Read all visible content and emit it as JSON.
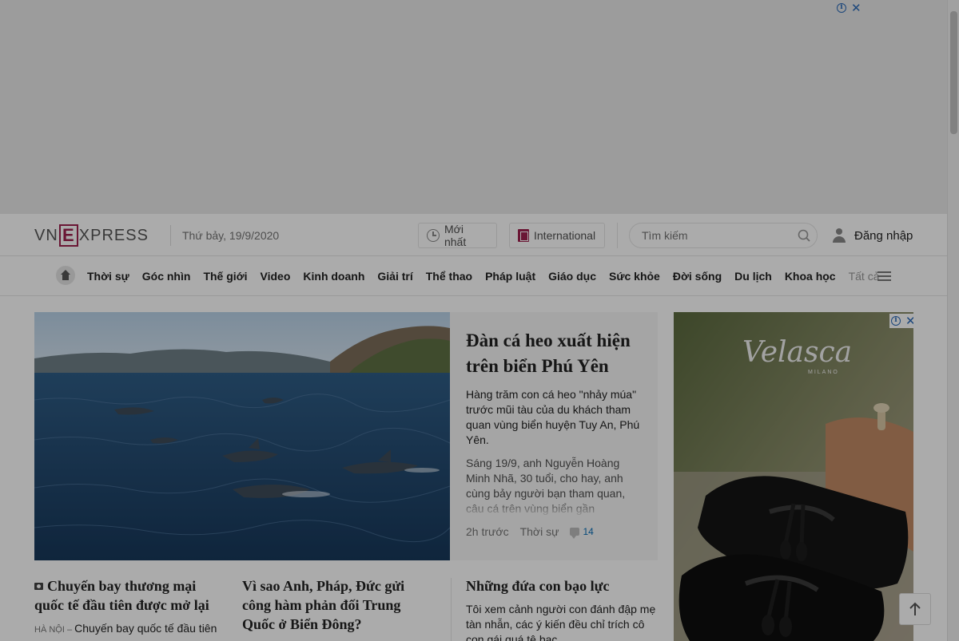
{
  "header": {
    "date": "Thứ bảy, 19/9/2020",
    "latest_label": "Mới nhất",
    "international_label": "International",
    "login_label": "Đăng nhập",
    "logo": {
      "vn": "VN",
      "e": "E",
      "xpress": "XPRESS"
    }
  },
  "search": {
    "placeholder": "Tìm kiếm"
  },
  "nav": {
    "items": [
      "Thời sự",
      "Góc nhìn",
      "Thế giới",
      "Video",
      "Kinh doanh",
      "Giải trí",
      "Thể thao",
      "Pháp luật",
      "Giáo dục",
      "Sức khỏe",
      "Đời sống",
      "Du lịch",
      "Khoa học"
    ],
    "more_label": "Tất cả"
  },
  "featured": {
    "title": "Đàn cá heo xuất hiện trên biển Phú Yên",
    "lead": "Hàng trăm con cá heo \"nhảy múa\" trước mũi tàu của du khách tham quan vùng biển huyện Tuy An, Phú Yên.",
    "body": "Sáng 19/9, anh Nguyễn Hoàng Minh Nhã, 30 tuổi, cho hay, anh cùng bảy người bạn tham quan, câu cá trên vùng biển gần",
    "time": "2h trước",
    "category": "Thời sự",
    "comments": "14"
  },
  "articles": [
    {
      "title": "Chuyến bay thương mại quốc tế đầu tiên được mở lại",
      "location": "HÀ NỘI",
      "lead": "Chuyến bay quốc tế đầu tiên"
    },
    {
      "title": "Vì sao Anh, Pháp, Đức gửi công hàm phản đối Trung Quốc ở Biển Đông?"
    },
    {
      "title": "Những đứa con bạo lực",
      "lead": "Tôi xem cảnh người con đánh đập mẹ tàn nhẫn, các ý kiến đều chỉ trích cô con gái quá tệ bạc"
    }
  ],
  "ads": {
    "brand": "Velasca",
    "brand_sub": "MILANO"
  },
  "colors": {
    "brand": "#9f224e",
    "link": "#076db6",
    "adchoice": "#2a6ab8"
  },
  "icons": {
    "close": "✕",
    "info": "i",
    "arrow_up": "↑"
  }
}
